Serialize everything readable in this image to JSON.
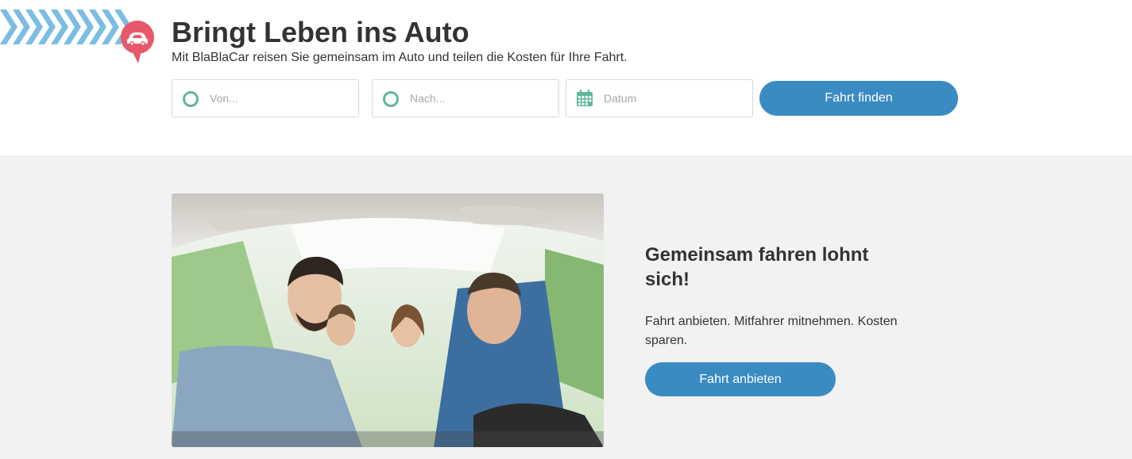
{
  "header": {
    "title": "Bringt Leben ins Auto",
    "subtitle": "Mit BlaBlaCar reisen Sie gemeinsam im Auto und teilen die Kosten für Ihre Fahrt."
  },
  "search": {
    "from_placeholder": "Von...",
    "to_placeholder": "Nach...",
    "date_placeholder": "Datum",
    "submit_label": "Fahrt finden"
  },
  "promo": {
    "title": "Gemeinsam fahren lohnt sich!",
    "text": "Fahrt anbieten. Mitfahrer mitnehmen. Kosten sparen.",
    "button_label": "Fahrt anbieten"
  },
  "icons": {
    "from": "ring-icon",
    "to": "ring-icon",
    "date": "calendar-icon",
    "badge": "car-speech-bubble-icon"
  },
  "colors": {
    "accent": "#3a8bc2",
    "ring": "#5fb79a",
    "badge": "#e8586b",
    "stripes": "#7bbde3",
    "section_bg": "#f2f2f2"
  }
}
